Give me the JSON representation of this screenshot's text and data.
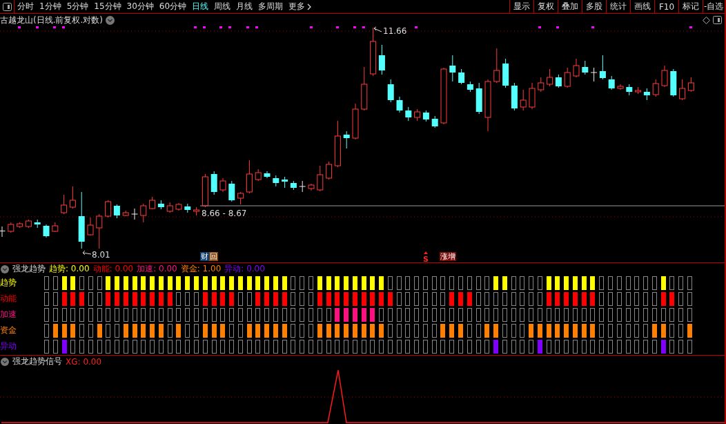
{
  "toolbar": {
    "periods": [
      {
        "label": "分时",
        "selected": false
      },
      {
        "label": "1分钟",
        "selected": false
      },
      {
        "label": "5分钟",
        "selected": false
      },
      {
        "label": "15分钟",
        "selected": false
      },
      {
        "label": "30分钟",
        "selected": false
      },
      {
        "label": "60分钟",
        "selected": false
      },
      {
        "label": "日线",
        "selected": true
      },
      {
        "label": "周线",
        "selected": false
      },
      {
        "label": "月线",
        "selected": false
      },
      {
        "label": "多周期",
        "selected": false
      }
    ],
    "more": "更多",
    "tools": [
      "显示",
      "复权",
      "叠加",
      "多股",
      "统计",
      "画线",
      "F10",
      "标记",
      "-自选"
    ]
  },
  "chart": {
    "title": "古越龙山(日线.前复权.对数)",
    "high_label": "11.66",
    "low_label": "8.01",
    "range_label": "8.66 - 8.67",
    "signal_mark": "S",
    "badges": [
      {
        "kind": "split",
        "parts": [
          {
            "text": "财",
            "color": "#0b3d6e"
          },
          {
            "text": "回",
            "color": "#8a4b12"
          }
        ]
      },
      {
        "kind": "plain",
        "parts": [
          {
            "text": "涨增",
            "color": "#7a0a0a"
          }
        ]
      }
    ]
  },
  "indicator": {
    "name": "强龙趋势",
    "values": [
      {
        "text": "趋势: 0.00",
        "color": "#ffff00"
      },
      {
        "text": "动能: 0.00",
        "color": "#ff0000"
      },
      {
        "text": "加速: 0.00",
        "color": "#ff1080"
      },
      {
        "text": "资金: 1.00",
        "color": "#ff8000"
      },
      {
        "text": "异动: 0.00",
        "color": "#8000ff"
      }
    ],
    "rows": [
      {
        "label": "趋势",
        "color": "#ffff00",
        "cells": [
          false,
          false,
          true,
          true,
          false,
          false,
          false,
          true,
          true,
          true,
          true,
          true,
          true,
          true,
          true,
          true,
          true,
          true,
          true,
          true,
          true,
          true,
          true,
          true,
          true,
          true,
          true,
          true,
          false,
          false,
          false,
          true,
          true,
          true,
          true,
          true,
          true,
          true,
          true,
          false,
          false,
          false,
          false,
          false,
          false,
          false,
          false,
          false,
          false,
          false,
          false,
          true,
          true,
          false,
          false,
          false,
          false,
          true,
          true,
          true,
          true,
          true,
          true,
          false,
          false,
          false,
          false,
          false,
          false,
          false,
          true,
          false,
          false,
          false
        ]
      },
      {
        "label": "动能",
        "color": "#ff0000",
        "cells": [
          false,
          false,
          true,
          true,
          true,
          false,
          false,
          true,
          true,
          true,
          true,
          true,
          true,
          true,
          true,
          false,
          false,
          false,
          true,
          true,
          true,
          true,
          false,
          false,
          true,
          true,
          true,
          true,
          false,
          false,
          false,
          true,
          true,
          true,
          true,
          true,
          true,
          true,
          true,
          true,
          false,
          false,
          false,
          false,
          false,
          false,
          true,
          true,
          true,
          false,
          false,
          false,
          false,
          false,
          false,
          false,
          false,
          true,
          true,
          true,
          true,
          true,
          true,
          false,
          false,
          false,
          false,
          false,
          false,
          false,
          true,
          true,
          false,
          false
        ]
      },
      {
        "label": "加速",
        "color": "#ff1080",
        "cells": [
          false,
          false,
          false,
          false,
          false,
          false,
          false,
          false,
          false,
          false,
          false,
          false,
          false,
          false,
          false,
          false,
          false,
          false,
          false,
          false,
          false,
          false,
          false,
          false,
          false,
          false,
          false,
          false,
          false,
          false,
          false,
          false,
          false,
          true,
          true,
          true,
          true,
          true,
          false,
          false,
          false,
          false,
          false,
          false,
          false,
          false,
          false,
          false,
          false,
          false,
          false,
          false,
          false,
          false,
          false,
          false,
          false,
          false,
          false,
          false,
          false,
          false,
          false,
          false,
          false,
          false,
          false,
          false,
          false,
          false,
          false,
          false,
          false,
          false
        ]
      },
      {
        "label": "资金",
        "color": "#ff8000",
        "cells": [
          false,
          true,
          true,
          true,
          false,
          false,
          true,
          false,
          false,
          true,
          true,
          true,
          true,
          true,
          false,
          true,
          false,
          false,
          true,
          true,
          true,
          false,
          false,
          true,
          true,
          true,
          true,
          true,
          false,
          false,
          false,
          true,
          true,
          true,
          true,
          true,
          true,
          true,
          true,
          false,
          false,
          false,
          false,
          false,
          false,
          true,
          true,
          true,
          false,
          false,
          true,
          true,
          false,
          false,
          false,
          true,
          true,
          true,
          true,
          true,
          true,
          true,
          true,
          false,
          false,
          false,
          false,
          false,
          false,
          true,
          true,
          false,
          false,
          true
        ]
      },
      {
        "label": "异动",
        "color": "#8000ff",
        "cells": [
          false,
          false,
          true,
          false,
          false,
          false,
          false,
          false,
          false,
          false,
          false,
          false,
          false,
          false,
          false,
          false,
          false,
          false,
          false,
          false,
          false,
          false,
          false,
          false,
          false,
          false,
          false,
          false,
          false,
          false,
          false,
          false,
          false,
          false,
          false,
          false,
          false,
          false,
          false,
          false,
          false,
          false,
          false,
          false,
          false,
          false,
          false,
          false,
          false,
          false,
          false,
          true,
          false,
          false,
          false,
          false,
          true,
          false,
          false,
          false,
          false,
          false,
          false,
          false,
          false,
          false,
          false,
          false,
          false,
          false,
          true,
          false,
          false,
          false
        ]
      }
    ]
  },
  "signal": {
    "name": "强龙趋势信号",
    "value": "XG: 0.00"
  }
}
